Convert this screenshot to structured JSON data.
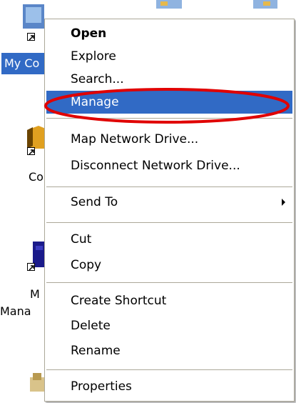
{
  "desktop": {
    "icons": [
      {
        "label": "My Co"
      },
      {
        "label": "Co"
      },
      {
        "label": "M"
      },
      {
        "label": "Mana"
      }
    ]
  },
  "context_menu": {
    "items": [
      {
        "label": "Open",
        "bold": true
      },
      {
        "label": "Explore"
      },
      {
        "label": "Search..."
      },
      {
        "label": "Manage",
        "highlighted": true
      },
      {
        "label": "Map Network Drive..."
      },
      {
        "label": "Disconnect Network Drive..."
      },
      {
        "label": "Send To",
        "has_submenu": true
      },
      {
        "label": "Cut"
      },
      {
        "label": "Copy"
      },
      {
        "label": "Create Shortcut"
      },
      {
        "label": "Delete"
      },
      {
        "label": "Rename"
      },
      {
        "label": "Properties"
      }
    ]
  },
  "colors": {
    "highlight": "#316ac5",
    "annotation": "#e00000",
    "menu_border": "#aca899"
  },
  "icons": [
    "my-computer-icon",
    "shortcut-arrow-icon",
    "submenu-arrow-icon",
    "folder-icon",
    "computer-management-icon"
  ]
}
